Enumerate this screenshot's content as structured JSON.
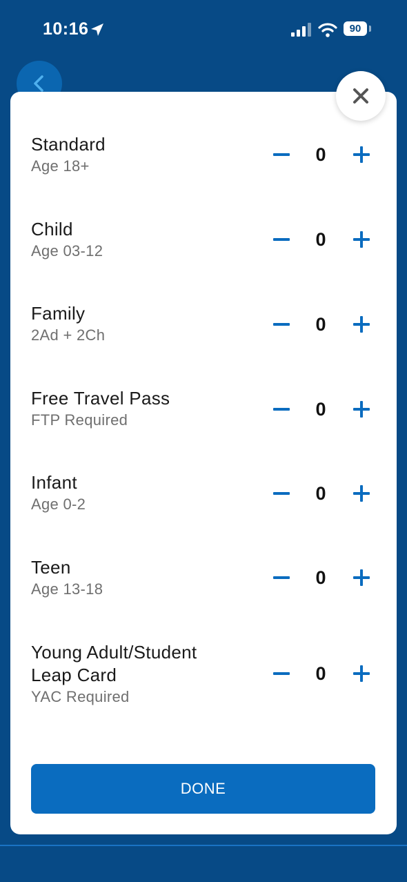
{
  "status_bar": {
    "time": "10:16",
    "battery": "90"
  },
  "modal": {
    "rows": [
      {
        "title": "Standard",
        "subtitle": "Age 18+",
        "quantity": "0"
      },
      {
        "title": "Child",
        "subtitle": "Age 03-12",
        "quantity": "0"
      },
      {
        "title": "Family",
        "subtitle": "2Ad + 2Ch",
        "quantity": "0"
      },
      {
        "title": "Free Travel Pass",
        "subtitle": "FTP Required",
        "quantity": "0"
      },
      {
        "title": "Infant",
        "subtitle": "Age 0-2",
        "quantity": "0"
      },
      {
        "title": "Teen",
        "subtitle": "Age 13-18",
        "quantity": "0"
      },
      {
        "title_line1": "Young Adult/Student",
        "title_line2": "Leap Card",
        "subtitle": "YAC Required",
        "quantity": "0"
      }
    ],
    "done_label": "DONE"
  },
  "colors": {
    "accent": "#0a6cbf",
    "background": "#074a86",
    "stepper": "#0a6cbf"
  }
}
